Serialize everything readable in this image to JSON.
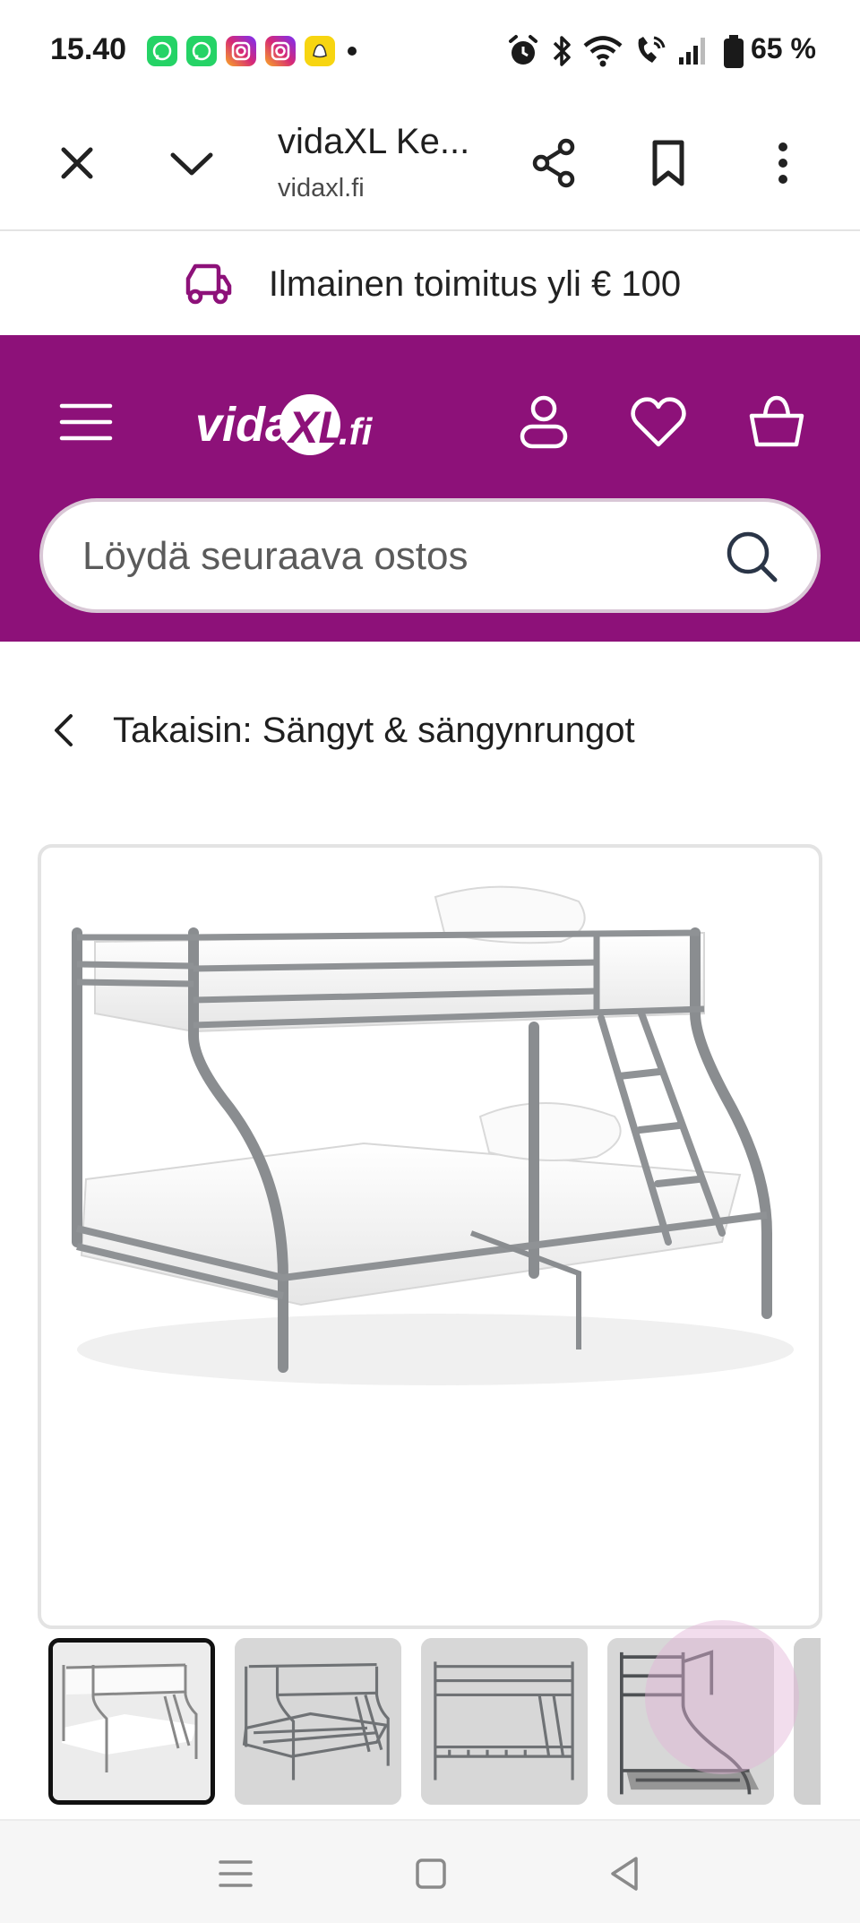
{
  "status_bar": {
    "time": "15.40",
    "battery": "65 %",
    "notification_icons": [
      "whatsapp-icon",
      "whatsapp-icon",
      "instagram-icon",
      "instagram-icon",
      "snapchat-icon"
    ],
    "system_icons": [
      "alarm-icon",
      "bluetooth-icon",
      "wifi-icon",
      "wifi-calling-icon",
      "signal-icon",
      "battery-icon"
    ],
    "colors": {
      "whatsapp": "#25d366",
      "instagram": "#d62976",
      "snapchat": "#f7d511"
    }
  },
  "browser": {
    "title": "vidaXL Ke...",
    "url": "vidaxl.fi",
    "icons": [
      "close-icon",
      "chevron-down-icon",
      "share-icon",
      "bookmark-icon",
      "more-vert-icon"
    ]
  },
  "promo": {
    "text": "Ilmainen toimitus yli € 100",
    "icon": "delivery-truck-icon"
  },
  "header": {
    "logo_text": "vidaXL.fi",
    "brand_color": "#8d1179",
    "icons": [
      "menu-icon",
      "account-icon",
      "heart-icon",
      "basket-icon"
    ],
    "search_placeholder": "Löydä seuraava ostos"
  },
  "back_link": {
    "label": "Takaisin: Sängyt & sängynrungot"
  },
  "gallery": {
    "main_image": "grey metal bunk bed with white mattresses",
    "thumbnail_count_visible": 5,
    "active_index": 0
  },
  "nav_bar": {
    "icons": [
      "recents-icon",
      "home-icon",
      "back-icon"
    ]
  }
}
